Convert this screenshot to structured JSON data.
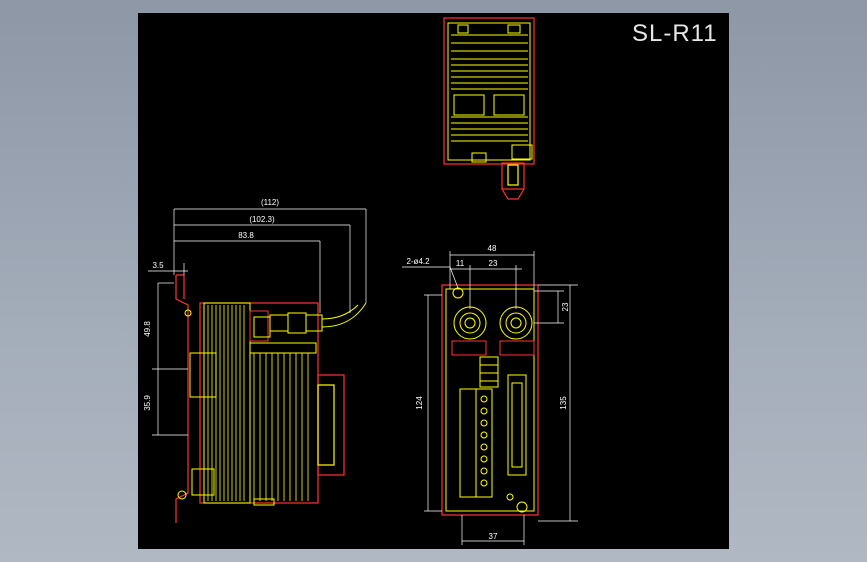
{
  "drawing": {
    "title": "SL-R11",
    "colors": {
      "background": "#000000",
      "outline": "#ffff00",
      "body": "#ff3333",
      "dimension": "#ffffff",
      "text": "#e6e6e6",
      "window": "#9aa3b0"
    },
    "side_view": {
      "dim_overall": "(112)",
      "dim_body": "(102.3)",
      "dim_depth": "83.8",
      "dim_tab": "3.5",
      "dim_upper": "49.8",
      "dim_lower": "35.9"
    },
    "front_view": {
      "dim_width": "48",
      "dim_offset": "11",
      "dim_pitch": "23",
      "dim_top": "23",
      "hole_callout": "2-ø4.2",
      "dim_height_inner": "124",
      "dim_height_total": "135",
      "dim_bottom": "37"
    }
  }
}
